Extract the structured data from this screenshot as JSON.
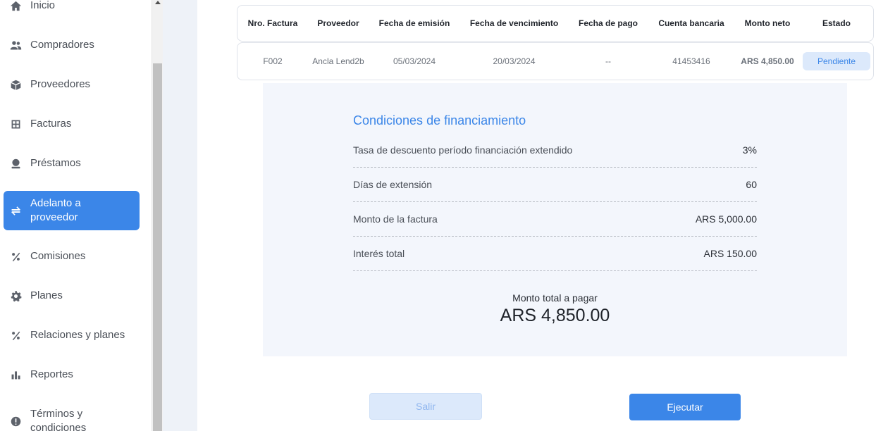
{
  "sidebar": {
    "items": [
      {
        "label": "Inicio",
        "icon": "home-icon"
      },
      {
        "label": "Compradores",
        "icon": "people-icon"
      },
      {
        "label": "Proveedores",
        "icon": "box-icon"
      },
      {
        "label": "Facturas",
        "icon": "grid-icon"
      },
      {
        "label": "Préstamos",
        "icon": "money-icon"
      },
      {
        "label": "Adelanto a proveedor",
        "icon": "swap-arrows-icon",
        "active": true
      },
      {
        "label": "Comisiones",
        "icon": "percent-icon"
      },
      {
        "label": "Planes",
        "icon": "gear-icon"
      },
      {
        "label": "Relaciones y planes",
        "icon": "percent-icon"
      },
      {
        "label": "Reportes",
        "icon": "bar-chart-icon"
      },
      {
        "label": "Términos y condiciones",
        "icon": "alert-icon"
      }
    ]
  },
  "table": {
    "headers": [
      "Nro. Factura",
      "Proveedor",
      "Fecha de emisión",
      "Fecha de vencimiento",
      "Fecha de pago",
      "Cuenta bancaria",
      "Monto neto",
      "Estado"
    ],
    "row": {
      "invoice": "F002",
      "provider": "Ancla Lend2b",
      "issue_date": "05/03/2024",
      "due_date": "20/03/2024",
      "payment_date": "--",
      "bank_account": "41453416",
      "net_amount": "ARS 4,850.00",
      "status": "Pendiente"
    }
  },
  "financing": {
    "title": "Condiciones de financiamiento",
    "rows": [
      {
        "label": "Tasa de descuento período financiación extendido",
        "value": "3%"
      },
      {
        "label": "Días de extensión",
        "value": "60"
      },
      {
        "label": "Monto de la factura",
        "value": "ARS 5,000.00"
      },
      {
        "label": "Interés total",
        "value": "ARS 150.00"
      }
    ],
    "total_label": "Monto total a pagar",
    "total_value": "ARS 4,850.00"
  },
  "actions": {
    "exit_label": "Salir",
    "execute_label": "Ejecutar"
  },
  "colors": {
    "accent": "#3b86e8",
    "badge_bg": "#dce9fb",
    "panel_bg": "#f3f6fc"
  }
}
